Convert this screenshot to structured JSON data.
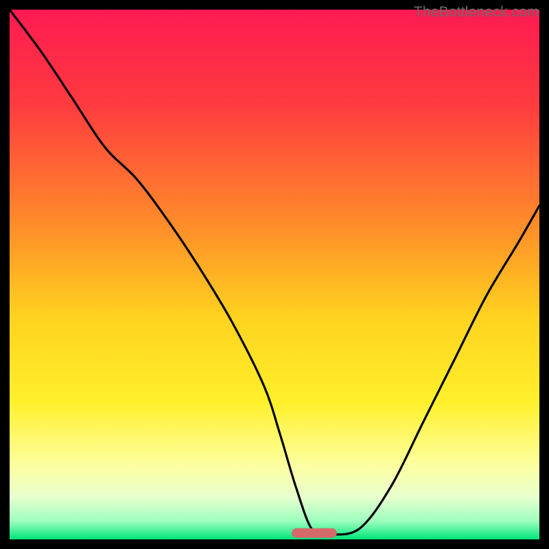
{
  "watermark": "TheBottleneck.com",
  "chart_data": {
    "type": "line",
    "title": "",
    "xlabel": "",
    "ylabel": "",
    "xlim": [
      0,
      100
    ],
    "ylim": [
      0,
      100
    ],
    "x": [
      0,
      6,
      12,
      18,
      24,
      30,
      36,
      42,
      48,
      51,
      54,
      57,
      60,
      66,
      72,
      78,
      84,
      90,
      96,
      100
    ],
    "values": [
      100,
      92,
      83,
      74,
      68,
      60,
      51,
      41,
      29,
      20,
      10,
      2,
      1,
      2,
      10,
      22,
      34,
      46,
      56,
      63
    ],
    "gradient_stops": [
      {
        "offset": 0.0,
        "color": "#ff1a52"
      },
      {
        "offset": 0.18,
        "color": "#ff3b3f"
      },
      {
        "offset": 0.4,
        "color": "#ff8a2a"
      },
      {
        "offset": 0.58,
        "color": "#ffd21f"
      },
      {
        "offset": 0.74,
        "color": "#fff02a"
      },
      {
        "offset": 0.86,
        "color": "#fdffa0"
      },
      {
        "offset": 0.92,
        "color": "#e8ffce"
      },
      {
        "offset": 0.965,
        "color": "#9fffc0"
      },
      {
        "offset": 1.0,
        "color": "#00e57a"
      }
    ],
    "marker": {
      "x": 57.5,
      "y": 1.2,
      "width": 8.5,
      "height": 1.8,
      "color": "#d46a6a",
      "rx": 1.0
    }
  }
}
